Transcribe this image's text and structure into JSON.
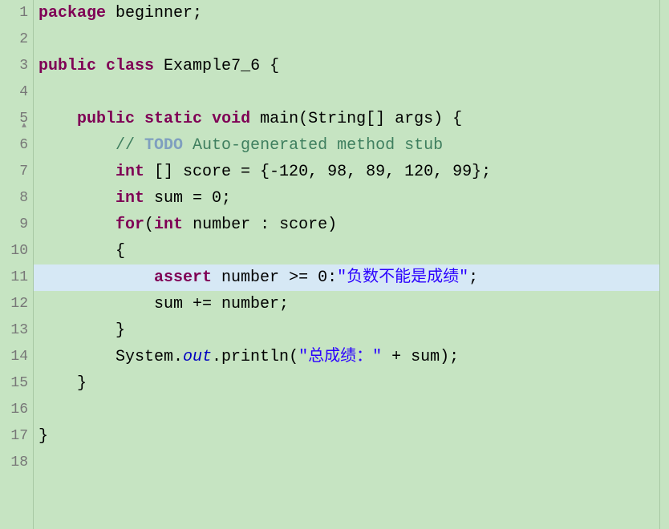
{
  "lines": [
    {
      "num": "1"
    },
    {
      "num": "2"
    },
    {
      "num": "3"
    },
    {
      "num": "4"
    },
    {
      "num": "5",
      "override": true,
      "markerBlue": true
    },
    {
      "num": "6",
      "markerTeal": true
    },
    {
      "num": "7"
    },
    {
      "num": "8"
    },
    {
      "num": "9"
    },
    {
      "num": "10"
    },
    {
      "num": "11"
    },
    {
      "num": "12"
    },
    {
      "num": "13"
    },
    {
      "num": "14"
    },
    {
      "num": "15",
      "markerBlue": true
    },
    {
      "num": "16"
    },
    {
      "num": "17"
    },
    {
      "num": "18"
    }
  ],
  "tokens": {
    "package": "package",
    "public": "public",
    "class": "class",
    "static": "static",
    "void": "void",
    "int": "int",
    "for": "for",
    "assert": "assert",
    "out": "out"
  },
  "identifiers": {
    "packageName": " beginner;",
    "className": " Example7_6 {",
    "mainDecl": " main(String[] args) {",
    "commentPrefix": "        // ",
    "todo": "TODO",
    "commentRest": " Auto-generated method stub",
    "scoreDecl": " [] score = {-120, 98, 89, 120, 99};",
    "sumDecl": " sum = 0;",
    "forDecl": " number : score)",
    "openBrace": "        {",
    "assertExpr": " number >= 0:",
    "assertStr": "\"负数不能是成绩\"",
    "assertEnd": ";",
    "sumStmt": "            sum += number;",
    "closeBrace": "        }",
    "printPrefix": "        System.",
    "printMid": ".println(",
    "printStr": "\"总成绩：\"",
    "printEnd": " + sum);",
    "methodClose": "    }",
    "classClose": "}"
  },
  "indent": {
    "one": "    ",
    "two": "        ",
    "three": "            "
  },
  "overrideSymbol": "▲"
}
